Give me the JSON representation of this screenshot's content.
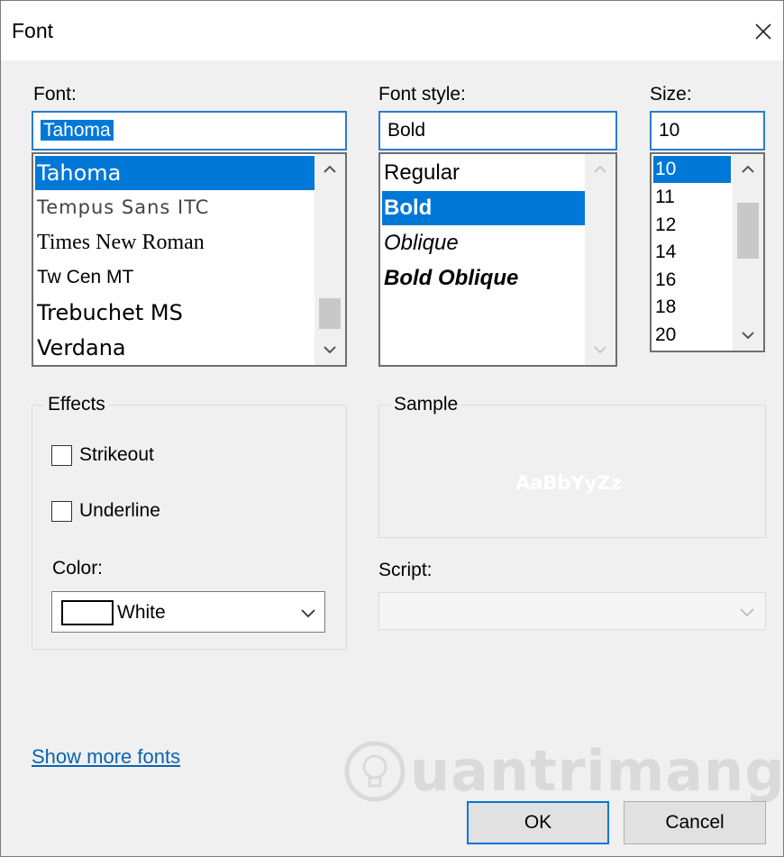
{
  "window": {
    "title": "Font"
  },
  "font": {
    "label": "Font:",
    "value": "Tahoma",
    "items": [
      "Tahoma",
      "Tempus Sans ITC",
      "Times New Roman",
      "Tw Cen MT",
      "Trebuchet MS",
      "Verdana"
    ],
    "selected_index": 0
  },
  "style": {
    "label": "Font style:",
    "value": "Bold",
    "items": [
      "Regular",
      "Bold",
      "Oblique",
      "Bold Oblique"
    ],
    "selected_index": 1
  },
  "size": {
    "label": "Size:",
    "value": "10",
    "items": [
      "10",
      "11",
      "12",
      "14",
      "16",
      "18",
      "20"
    ],
    "selected_index": 0
  },
  "effects": {
    "title": "Effects",
    "strikeout_label": "Strikeout",
    "strikeout_checked": false,
    "underline_label": "Underline",
    "underline_checked": false,
    "color_label": "Color:",
    "color_value": "White",
    "color_hex": "#ffffff"
  },
  "sample": {
    "title": "Sample",
    "text": "AaBbYyZz"
  },
  "script": {
    "label": "Script:",
    "value": ""
  },
  "links": {
    "show_more": "Show more fonts"
  },
  "buttons": {
    "ok": "OK",
    "cancel": "Cancel"
  },
  "watermark": {
    "text": "uantrimang"
  },
  "colors": {
    "accent": "#0078d7",
    "link": "#0a64ad",
    "dialog_bg": "#f0f0f0"
  },
  "icons": {
    "close": "close-icon",
    "scroll_up": "chevron-up-icon",
    "scroll_down": "chevron-down-icon",
    "dropdown": "chevron-down-icon",
    "watermark": "lightbulb-icon"
  }
}
